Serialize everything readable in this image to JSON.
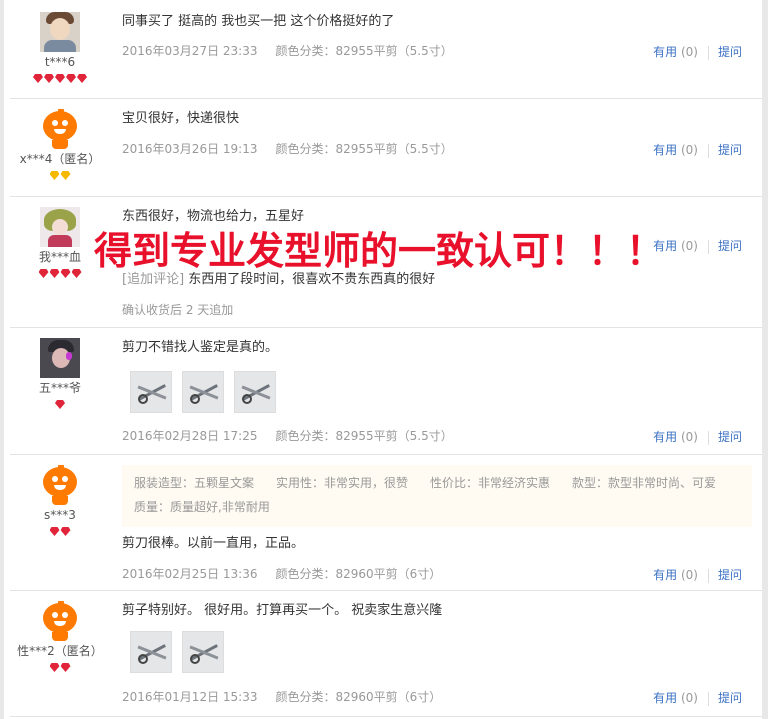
{
  "reviews": [
    {
      "user": "t***6",
      "text": "同事买了 挺高的 我也买一把 这个价格挺好的了",
      "date": "2016年03月27日 23:33",
      "color": "颜色分类：82955平剪（5.5寸）",
      "helpful_label": "有用",
      "helpful_count": "(0)",
      "ask_label": "提问"
    },
    {
      "user": "x***4（匿名）",
      "text": "宝贝很好，快递很快",
      "date": "2016年03月26日 19:13",
      "color": "颜色分类：82955平剪（5.5寸）",
      "helpful_label": "有用",
      "helpful_count": "(0)",
      "ask_label": "提问"
    },
    {
      "user": "我***血",
      "text": "东西很好，物流也给力，五星好",
      "append_tag": "[追加评论]",
      "append_text": "东西用了段时间，很喜欢不贵东西真的很好",
      "append_note": "确认收货后 2 天追加",
      "helpful_label": "有用",
      "helpful_count": "(0)",
      "ask_label": "提问"
    },
    {
      "user": "五***爷",
      "text": "剪刀不错找人鉴定是真的。",
      "date": "2016年02月28日 17:25",
      "color": "颜色分类：82955平剪（5.5寸）",
      "helpful_label": "有用",
      "helpful_count": "(0)",
      "ask_label": "提问"
    },
    {
      "user": "s***3",
      "tags": [
        "服装造型：五颗星文案",
        "实用性：非常实用，很赞",
        "性价比：非常经济实惠",
        "款型：款型非常时尚、可爱",
        "质量：质量超好,非常耐用"
      ],
      "text": "剪刀很棒。以前一直用，正品。",
      "date": "2016年02月25日 13:36",
      "color": "颜色分类：82960平剪（6寸）",
      "helpful_label": "有用",
      "helpful_count": "(0)",
      "ask_label": "提问"
    },
    {
      "user": "性***2（匿名）",
      "text": "剪子特别好。 很好用。打算再买一个。 祝卖家生意兴隆",
      "date": "2016年01月12日 15:33",
      "color": "颜色分类：82960平剪（6寸）",
      "helpful_label": "有用",
      "helpful_count": "(0)",
      "ask_label": "提问"
    }
  ],
  "overlay_banner": "得到专业发型师的一致认可！！！",
  "colors": {
    "link": "#3c72c4",
    "overlay": "#e8102a",
    "badge_red": "#e0243a",
    "badge_gold": "#f6b800"
  }
}
